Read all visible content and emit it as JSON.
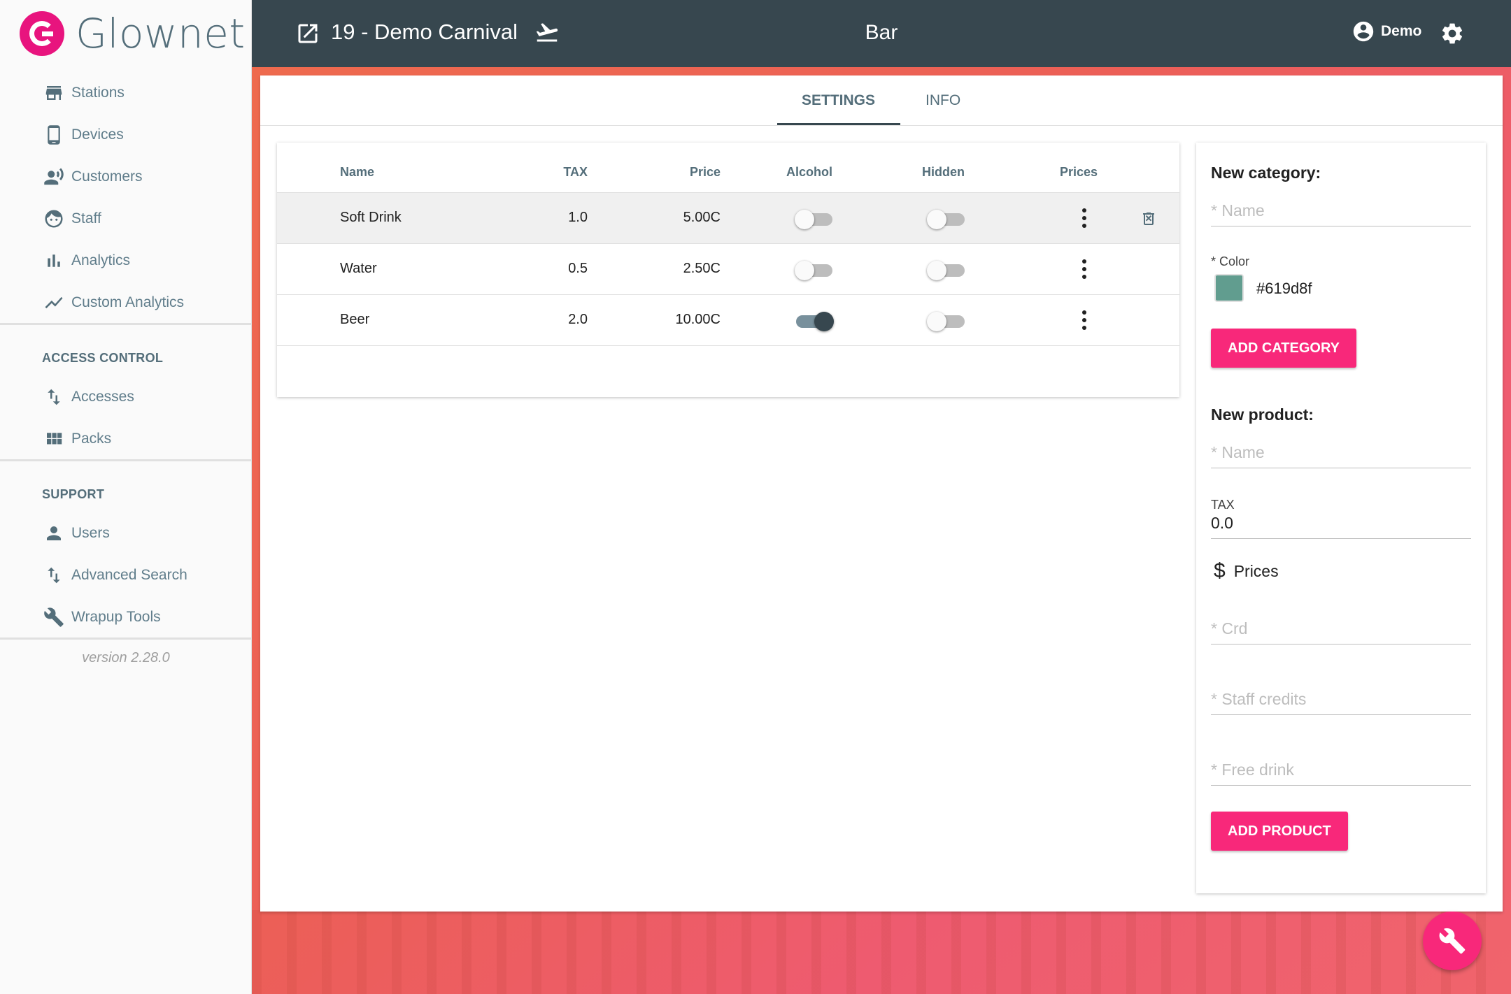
{
  "app": {
    "name": "Glownet",
    "version": "version 2.28.0"
  },
  "sidebar": {
    "items": [
      {
        "label": "Stations",
        "icon": "store-icon"
      },
      {
        "label": "Devices",
        "icon": "phone-icon"
      },
      {
        "label": "Customers",
        "icon": "customers-icon"
      },
      {
        "label": "Staff",
        "icon": "face-icon"
      },
      {
        "label": "Analytics",
        "icon": "bar-chart-icon"
      },
      {
        "label": "Custom Analytics",
        "icon": "trending-icon"
      }
    ],
    "access_control": {
      "heading": "ACCESS CONTROL",
      "items": [
        {
          "label": "Accesses",
          "icon": "swap-vert-icon"
        },
        {
          "label": "Packs",
          "icon": "grid-icon"
        }
      ]
    },
    "support": {
      "heading": "SUPPORT",
      "items": [
        {
          "label": "Users",
          "icon": "person-icon"
        },
        {
          "label": "Advanced Search",
          "icon": "swap-vert-icon"
        },
        {
          "label": "Wrapup Tools",
          "icon": "wrench-icon"
        }
      ]
    }
  },
  "header": {
    "event_title": "19 - Demo Carnival",
    "page_title": "Bar",
    "user_name": "Demo"
  },
  "tabs": [
    {
      "label": "SETTINGS",
      "active": true
    },
    {
      "label": "INFO",
      "active": false
    }
  ],
  "table": {
    "columns": [
      "Name",
      "TAX",
      "Price",
      "Alcohol",
      "Hidden",
      "Prices"
    ],
    "rows": [
      {
        "name": "Soft Drink",
        "tax": "1.0",
        "price": "5.00C",
        "alcohol": false,
        "hidden": false
      },
      {
        "name": "Water",
        "tax": "0.5",
        "price": "2.50C",
        "alcohol": false,
        "hidden": false
      },
      {
        "name": "Beer",
        "tax": "2.0",
        "price": "10.00C",
        "alcohol": true,
        "hidden": false
      }
    ]
  },
  "new_category": {
    "heading": "New category:",
    "name_placeholder": "* Name",
    "color_label": "* Color",
    "color_value": "#619d8f",
    "button": "ADD CATEGORY"
  },
  "new_product": {
    "heading": "New product:",
    "name_placeholder": "* Name",
    "tax_label": "TAX",
    "tax_value": "0.0",
    "prices_heading": "Prices",
    "crd_placeholder": "* Crd",
    "staff_credits_placeholder": "* Staff credits",
    "free_drink_placeholder": "* Free drink",
    "button": "ADD PRODUCT"
  },
  "colors": {
    "accent": "#f8287a",
    "topbar": "#37474f",
    "brand": "#e8147e"
  }
}
